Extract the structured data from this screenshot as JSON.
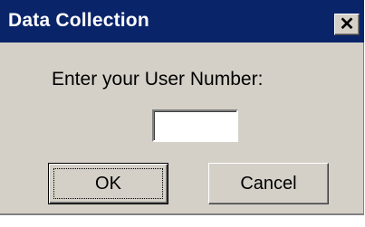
{
  "window": {
    "title": "Data Collection",
    "close_glyph": "✕",
    "close_icon": "close-icon"
  },
  "form": {
    "prompt": "Enter your User Number:",
    "user_number_value": ""
  },
  "buttons": {
    "ok_label": "OK",
    "cancel_label": "Cancel"
  },
  "colors": {
    "titlebar": "#0a246a",
    "face": "#d4d0c8"
  }
}
